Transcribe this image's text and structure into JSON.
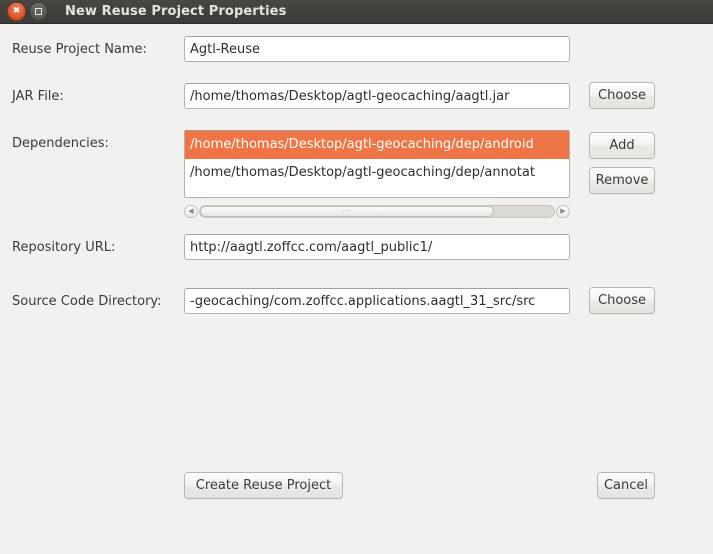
{
  "window": {
    "title": "New Reuse Project Properties",
    "close_icon": "close-icon",
    "maximize_icon": "maximize-icon",
    "titlebar_bg": "#3c3b37",
    "titlebar_fg": "#e6e2dc",
    "body_bg": "#f2f1f0",
    "selection_color": "#ef7446"
  },
  "form": {
    "project_name": {
      "label": "Reuse Project Name:",
      "value": "Agtl-Reuse",
      "placeholder": ""
    },
    "jar_file": {
      "label": "JAR File:",
      "value": "/home/thomas/Desktop/agtl-geocaching/aagtl.jar",
      "placeholder": "",
      "button": "Choose"
    },
    "dependencies": {
      "label": "Dependencies:",
      "items": [
        {
          "value": "/home/thomas/Desktop/agtl-geocaching/dep/android",
          "selected": true
        },
        {
          "value": "/home/thomas/Desktop/agtl-geocaching/dep/annotat",
          "selected": false
        }
      ],
      "add_button": "Add",
      "remove_button": "Remove",
      "scrollbar": {
        "left_arrow": "◀",
        "right_arrow": "▶",
        "grip": "⋯"
      }
    },
    "repository_url": {
      "label": "Repository URL:",
      "value": "http://aagtl.zoffcc.com/aagtl_public1/",
      "placeholder": ""
    },
    "source_code_directory": {
      "label": "Source Code Directory:",
      "value": "-geocaching/com.zoffcc.applications.aagtl_31_src/src",
      "placeholder": "",
      "button": "Choose"
    }
  },
  "actions": {
    "create": "Create Reuse Project",
    "cancel": "Cancel"
  }
}
